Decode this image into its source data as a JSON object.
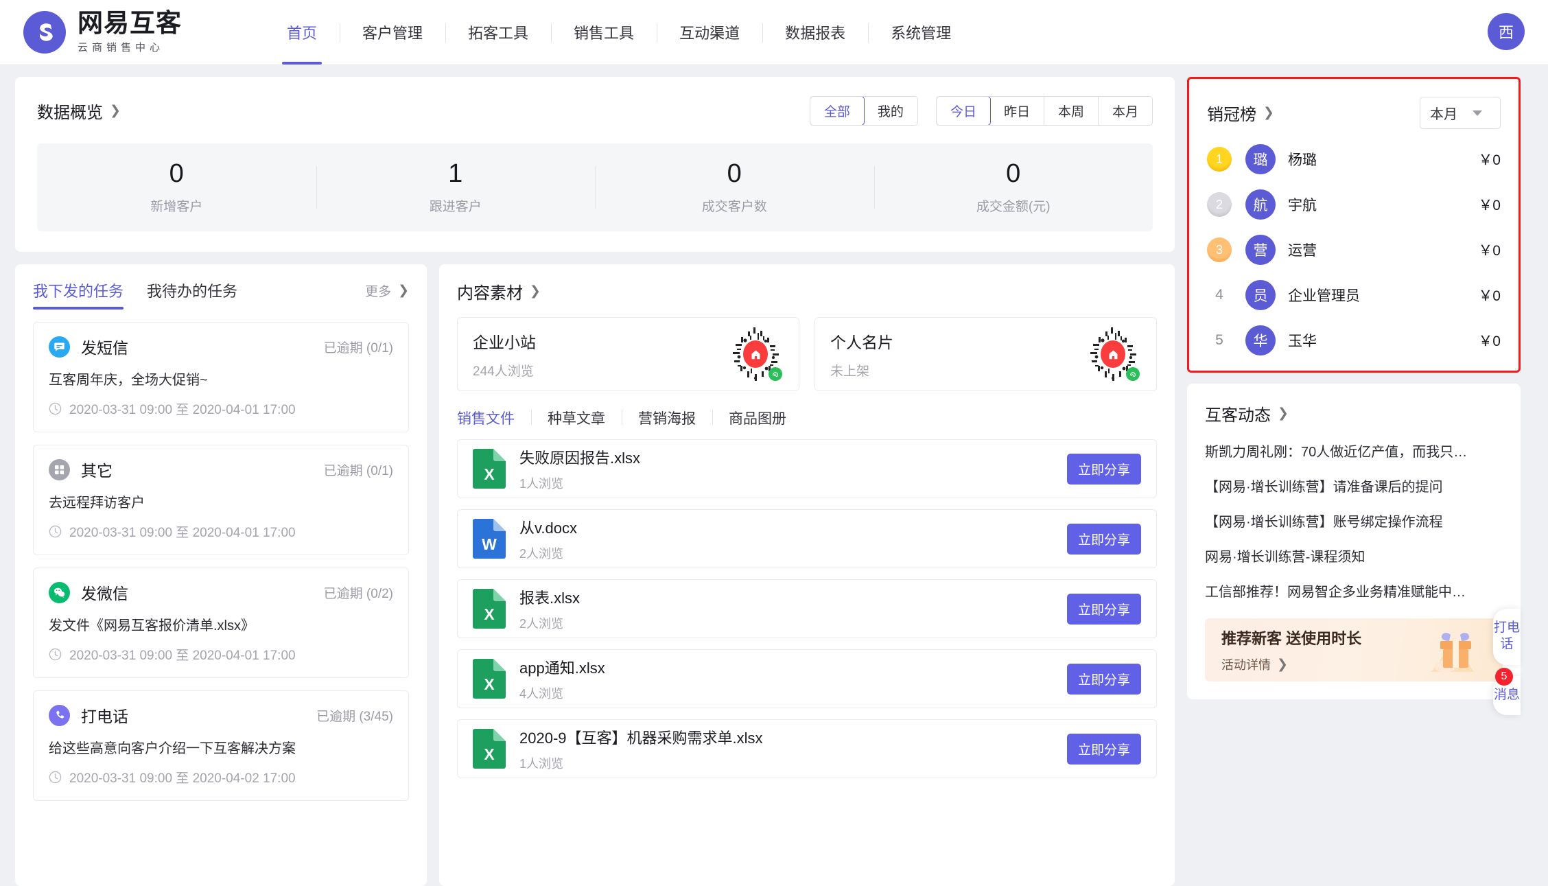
{
  "header": {
    "brand_name": "网易互客",
    "brand_sub": "云商销售中心",
    "nav": [
      {
        "label": "首页",
        "active": true
      },
      {
        "label": "客户管理",
        "active": false
      },
      {
        "label": "拓客工具",
        "active": false
      },
      {
        "label": "销售工具",
        "active": false
      },
      {
        "label": "互动渠道",
        "active": false
      },
      {
        "label": "数据报表",
        "active": false
      },
      {
        "label": "系统管理",
        "active": false
      }
    ],
    "avatar_text": "西"
  },
  "overview": {
    "title": "数据概览",
    "scope_filters": [
      {
        "label": "全部",
        "active": true
      },
      {
        "label": "我的",
        "active": false
      }
    ],
    "time_filters": [
      {
        "label": "今日",
        "active": true
      },
      {
        "label": "昨日",
        "active": false
      },
      {
        "label": "本周",
        "active": false
      },
      {
        "label": "本月",
        "active": false
      }
    ],
    "stats": [
      {
        "value": "0",
        "label": "新增客户"
      },
      {
        "value": "1",
        "label": "跟进客户"
      },
      {
        "value": "0",
        "label": "成交客户数"
      },
      {
        "value": "0",
        "label": "成交金额(元)"
      }
    ]
  },
  "tasks": {
    "tabs": [
      {
        "label": "我下发的任务",
        "active": true
      },
      {
        "label": "我待办的任务",
        "active": false
      }
    ],
    "more_label": "更多",
    "items": [
      {
        "icon": "sms-icon",
        "title": "发短信",
        "status": "已逾期 (0/1)",
        "desc": "互客周年庆，全场大促销~",
        "time": "2020-03-31 09:00 至 2020-04-01 17:00"
      },
      {
        "icon": "grid-icon",
        "title": "其它",
        "status": "已逾期 (0/1)",
        "desc": "去远程拜访客户",
        "time": "2020-03-31 09:00 至 2020-04-01 17:00"
      },
      {
        "icon": "wechat-icon",
        "title": "发微信",
        "status": "已逾期 (0/2)",
        "desc": "发文件《网易互客报价清单.xlsx》",
        "time": "2020-03-31 09:00 至 2020-04-01 17:00"
      },
      {
        "icon": "phone-icon",
        "title": "打电话",
        "status": "已逾期 (3/45)",
        "desc": "给这些高意向客户介绍一下互客解决方案",
        "time": "2020-03-31 09:00 至 2020-04-02 17:00"
      }
    ]
  },
  "materials": {
    "title": "内容素材",
    "cards": [
      {
        "title": "企业小站",
        "sub": "244人浏览"
      },
      {
        "title": "个人名片",
        "sub": "未上架"
      }
    ],
    "file_tabs": [
      {
        "label": "销售文件",
        "active": true
      },
      {
        "label": "种草文章",
        "active": false
      },
      {
        "label": "营销海报",
        "active": false
      },
      {
        "label": "商品图册",
        "active": false
      }
    ],
    "share_label": "立即分享",
    "files": [
      {
        "type": "xlsx",
        "name": "失败原因报告.xlsx",
        "views": "1人浏览"
      },
      {
        "type": "docx",
        "name": "从v.docx",
        "views": "2人浏览"
      },
      {
        "type": "xlsx",
        "name": "报表.xlsx",
        "views": "2人浏览"
      },
      {
        "type": "xlsx",
        "name": "app通知.xlsx",
        "views": "4人浏览"
      },
      {
        "type": "xlsx",
        "name": "2020-9【互客】机器采购需求单.xlsx",
        "views": "1人浏览"
      }
    ]
  },
  "ranking": {
    "title": "销冠榜",
    "period": "本月",
    "rows": [
      {
        "rank": "1",
        "avatar": "璐",
        "name": "杨璐",
        "amount": "￥0"
      },
      {
        "rank": "2",
        "avatar": "航",
        "name": "宇航",
        "amount": "￥0"
      },
      {
        "rank": "3",
        "avatar": "营",
        "name": "运营",
        "amount": "￥0"
      },
      {
        "rank": "4",
        "avatar": "员",
        "name": "企业管理员",
        "amount": "￥0"
      },
      {
        "rank": "5",
        "avatar": "华",
        "name": "玉华",
        "amount": "￥0"
      }
    ]
  },
  "news": {
    "title": "互客动态",
    "items": [
      "斯凯力周礼刚：70人做近亿产值，而我只…",
      "【网易·增长训练营】请准备课后的提问",
      "【网易·增长训练营】账号绑定操作流程",
      "网易·增长训练营-课程须知",
      "工信部推荐！网易智企多业务精准赋能中…"
    ]
  },
  "promo": {
    "title": "推荐新客 送使用时长",
    "link": "活动详情"
  },
  "rail": {
    "call_label": "打电话",
    "message_label": "消息",
    "message_badge": "5"
  },
  "colors": {
    "accent": "#5b5bd6",
    "share_button": "#6161e8",
    "highlight_border": "#f51a1a",
    "sms": "#29a9f2",
    "wechat": "#09bb6f",
    "phone": "#7b72ef",
    "other": "#a5a5ad",
    "excel": "#1d9f5e",
    "word": "#2b72d9"
  }
}
